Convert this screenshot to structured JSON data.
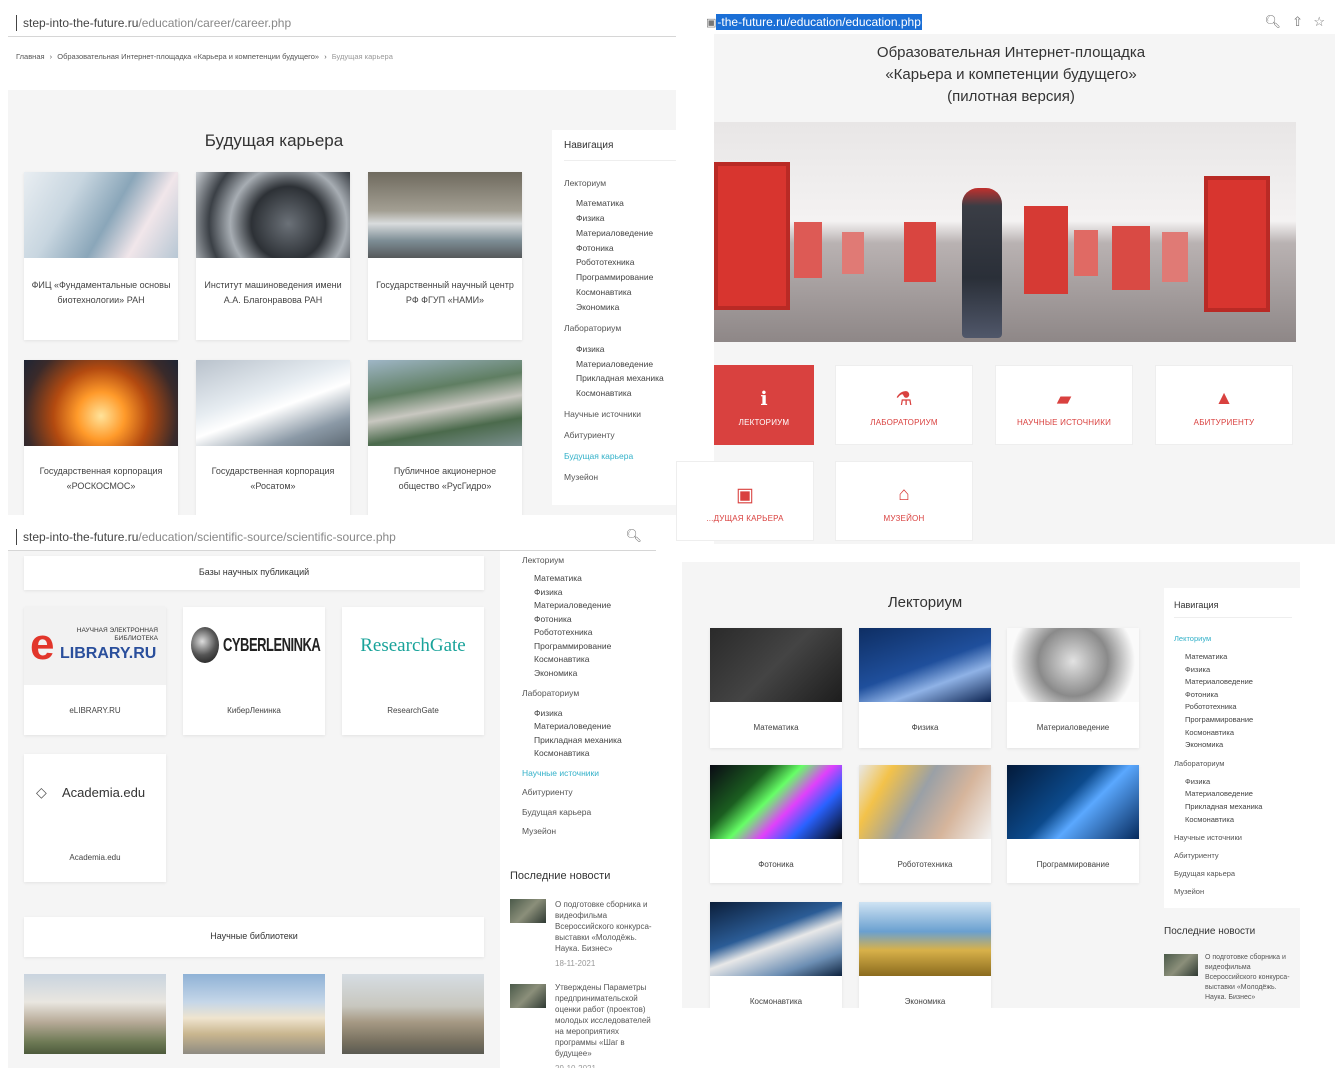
{
  "panel1": {
    "url_domain": "step-into-the-future.ru",
    "url_path": "/education/career/career.php",
    "breadcrumb": [
      "Главная",
      "›",
      "Образовательная Интернет-площадка «Карьера и компетенции будущего»",
      "›",
      "Будущая карьера"
    ],
    "title": "Будущая карьера",
    "cards": [
      {
        "caption": "ФИЦ «Фундаментальные основы биотехнологии» РАН"
      },
      {
        "caption": "Институт машиноведения имени А.А. Благонравова РАН"
      },
      {
        "caption": "Государственный научный центр РФ ФГУП «НАМИ»"
      },
      {
        "caption": "Государственная корпорация «РОСКОСМОС»"
      },
      {
        "caption": "Государственная корпорация «Росатом»"
      },
      {
        "caption": "Публичное акционерное общество «РусГидро»"
      }
    ],
    "nav": {
      "heading": "Навигация",
      "items": [
        "Лекториум",
        "Математика",
        "Физика",
        "Материаловедение",
        "Фотоника",
        "Робототехника",
        "Программирование",
        "Космонавтика",
        "Экономика",
        "Лабораториум",
        "Физика",
        "Материаловедение",
        "Прикладная механика",
        "Космонавтика",
        "Научные источники",
        "Абитуриенту",
        "Будущая карьера",
        "Музейон"
      ]
    }
  },
  "panel2": {
    "url_domain_prefix": "",
    "url_selected": "-the-future.ru/education/education.php",
    "heading_lines": [
      "Образовательная Интернет-площадка",
      "«Карьера и компетенции будущего»",
      "(пилотная версия)"
    ],
    "tiles": [
      {
        "icon": "info-icon",
        "glyph": "ℹ",
        "label": "ЛЕКТОРИУМ"
      },
      {
        "icon": "flask-icon",
        "glyph": "⚗",
        "label": "ЛАБОРАТОРИУМ"
      },
      {
        "icon": "book-icon",
        "glyph": "▰",
        "label": "НАУЧНЫЕ ИСТОЧНИКИ"
      },
      {
        "icon": "graduation-cap-icon",
        "glyph": "▲",
        "label": "АБИТУРИЕНТУ"
      },
      {
        "icon": "briefcase-icon",
        "glyph": "▣",
        "label": "...ДУЩАЯ КАРЬЕРА"
      },
      {
        "icon": "museum-icon",
        "glyph": "⌂",
        "label": "МУЗЕЙОН"
      }
    ]
  },
  "panel3": {
    "url_domain": "step-into-the-future.ru",
    "url_path": "/education/scientific-source/scientific-source.php",
    "section1": "Базы научных публикаций",
    "logos": [
      {
        "logo_top": "НАУЧНАЯ ЭЛЕКТРОННАЯ БИБЛИОТЕКА",
        "logo_main": "LIBRARY.RU",
        "caption": "eLIBRARY.RU"
      },
      {
        "logo_main": "CYBERLENINKA",
        "caption": "КиберЛенинка"
      },
      {
        "logo_main": "ResearchGate",
        "caption": "ResearchGate"
      },
      {
        "logo_main": "Academia.edu",
        "caption": "Academia.edu"
      }
    ],
    "section2": "Научные библиотеки",
    "nav_items": [
      "Лекториум",
      "Математика",
      "Физика",
      "Материаловедение",
      "Фотоника",
      "Робототехника",
      "Программирование",
      "Космонавтика",
      "Экономика",
      "Лабораториум",
      "Физика",
      "Материаловедение",
      "Прикладная механика",
      "Космонавтика",
      "Научные источники",
      "Абитуриенту",
      "Будущая карьера",
      "Музейон"
    ],
    "news_heading": "Последние новости",
    "news": [
      {
        "text": "О подготовке сборника и видеофильма Всероссийского конкурса-выставки «Молодёжь. Наука. Бизнес»",
        "date": "18-11-2021"
      },
      {
        "text": "Утверждены Параметры предпринимательской оценки работ (проектов) молодых исследователей на мероприятиях программы «Шаг в будущее»",
        "date": "29-10-2021"
      }
    ]
  },
  "panel4": {
    "title": "Лекториум",
    "cards": [
      {
        "caption": "Математика"
      },
      {
        "caption": "Физика"
      },
      {
        "caption": "Материаловедение"
      },
      {
        "caption": "Фотоника"
      },
      {
        "caption": "Робототехника"
      },
      {
        "caption": "Программирование"
      },
      {
        "caption": "Космонавтика"
      },
      {
        "caption": "Экономика"
      }
    ],
    "nav": {
      "heading": "Навигация",
      "items": [
        "Лекториум",
        "Математика",
        "Физика",
        "Материаловедение",
        "Фотоника",
        "Робототехника",
        "Программирование",
        "Космонавтика",
        "Экономика",
        "Лабораториум",
        "Физика",
        "Материаловедение",
        "Прикладная механика",
        "Космонавтика",
        "Научные источники",
        "Абитуриенту",
        "Будущая карьера",
        "Музейон"
      ]
    },
    "news_heading": "Последние новости",
    "news": [
      {
        "text": "О подготовке сборника и видеофильма Всероссийского конкурса-выставки «Молодёжь. Наука. Бизнес»"
      }
    ]
  }
}
